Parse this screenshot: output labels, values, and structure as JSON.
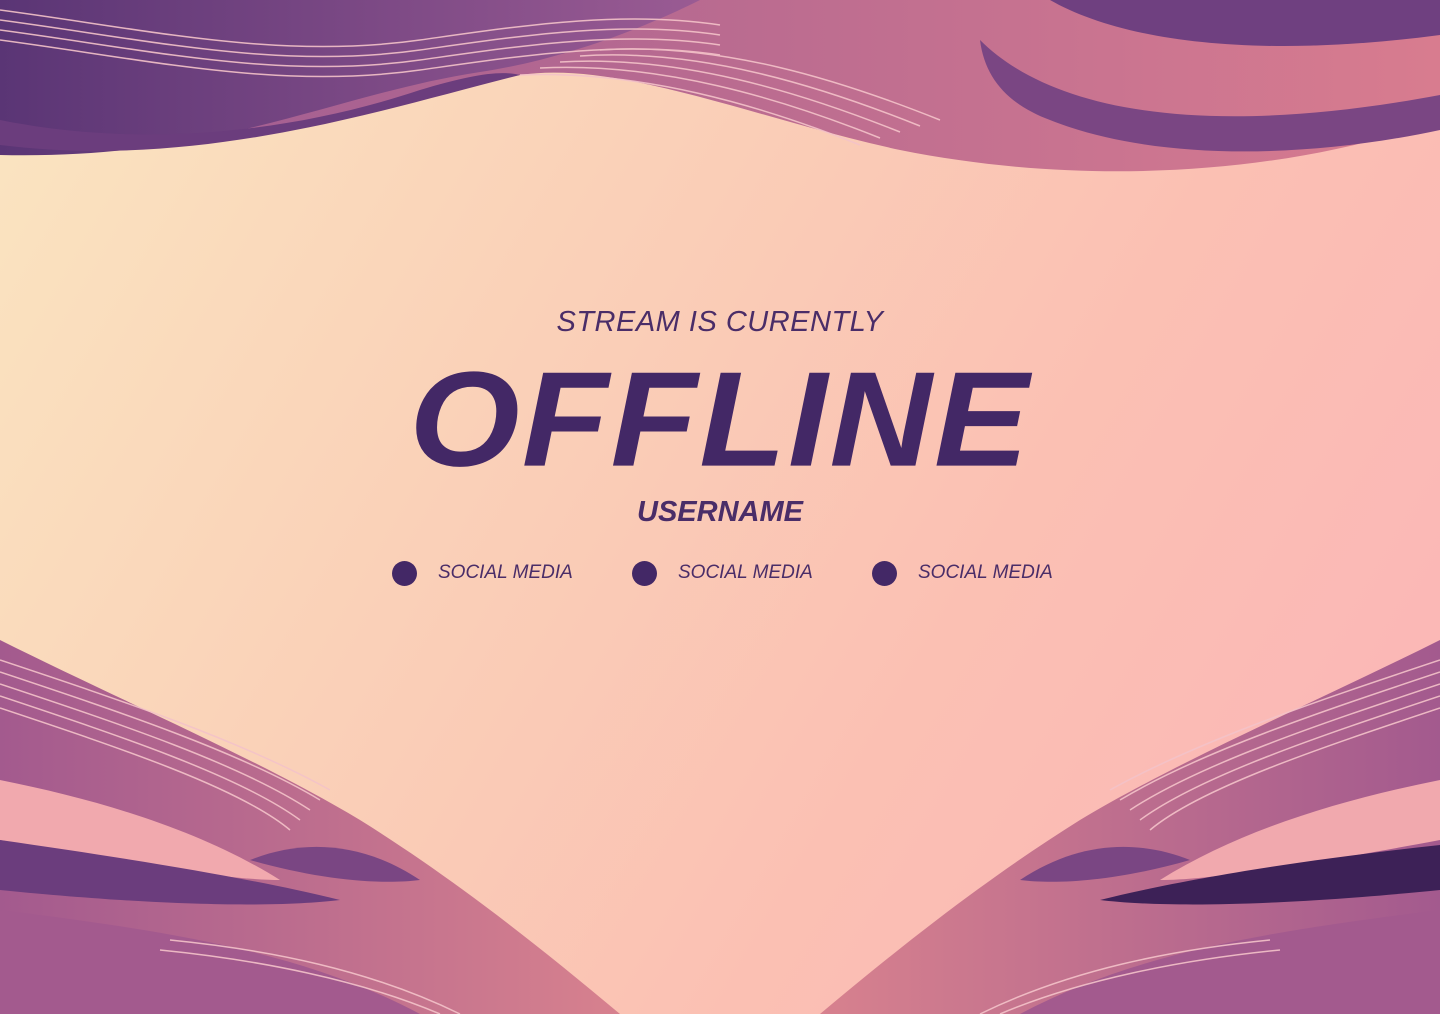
{
  "banner": {
    "subtitle": "STREAM IS CURENTLY",
    "headline": "OFFLINE",
    "username": "USERNAME"
  },
  "socials": [
    {
      "label": "SOCIAL MEDIA",
      "icon": "dot-icon"
    },
    {
      "label": "SOCIAL MEDIA",
      "icon": "dot-icon"
    },
    {
      "label": "SOCIAL MEDIA",
      "icon": "dot-icon"
    }
  ],
  "colors": {
    "text": "#432866",
    "wave_dark": "#5a3575",
    "wave_mid": "#a55a8f",
    "wave_light": "#d87c8f",
    "background_start": "#fae6c1",
    "background_end": "#fbb4b8"
  }
}
